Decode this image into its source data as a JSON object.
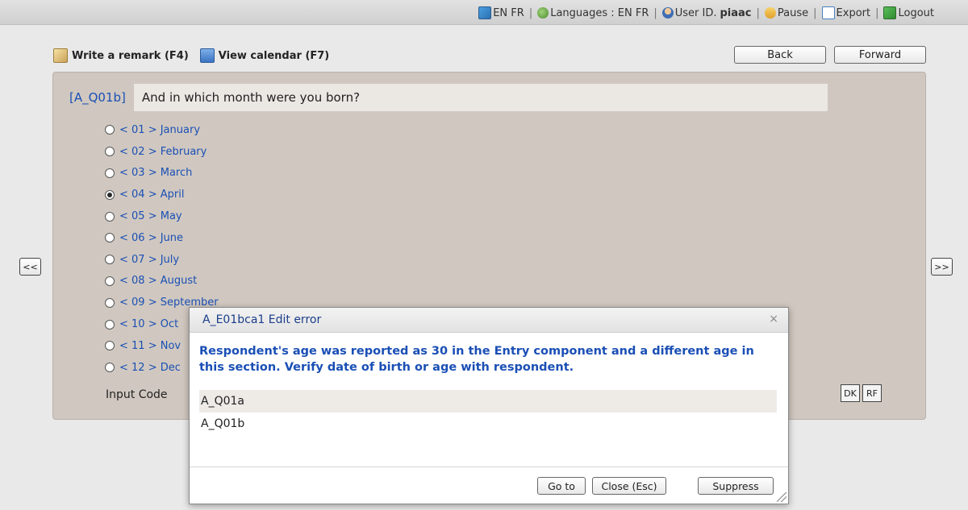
{
  "topbar": {
    "lang_toggle": "EN FR",
    "languages_label": "Languages : EN FR",
    "user_label": "User ID.",
    "user_id": "piaac",
    "pause": "Pause",
    "export": "Export",
    "logout": "Logout",
    "separator": "|"
  },
  "toolbar": {
    "remark": "Write a remark (F4)",
    "calendar": "View calendar (F7)",
    "back": "Back",
    "forward": "Forward"
  },
  "nav": {
    "prev": "<<",
    "next": ">>"
  },
  "question": {
    "code": "[A_Q01b]",
    "text": "And in which month were you born?",
    "options": [
      {
        "label": "< 01 > January",
        "checked": false
      },
      {
        "label": "< 02 > February",
        "checked": false
      },
      {
        "label": "< 03 > March",
        "checked": false
      },
      {
        "label": "< 04 > April",
        "checked": true
      },
      {
        "label": "< 05 > May",
        "checked": false
      },
      {
        "label": "< 06 > June",
        "checked": false
      },
      {
        "label": "< 07 > July",
        "checked": false
      },
      {
        "label": "< 08 > August",
        "checked": false
      },
      {
        "label": "< 09 > September",
        "checked": false
      },
      {
        "label": "< 10 > Oct",
        "checked": false
      },
      {
        "label": "< 11 > Nov",
        "checked": false
      },
      {
        "label": "< 12 > Dec",
        "checked": false
      }
    ],
    "input_code_label": "Input Code",
    "dk": "DK",
    "rf": "RF"
  },
  "dialog": {
    "title": "A_E01bca1 Edit error",
    "close_icon": "×",
    "message": "Respondent's age was reported as 30 in the Entry component and a different age in this section. Verify date of birth or age with respondent.",
    "items": [
      "A_Q01a",
      "A_Q01b"
    ],
    "goto": "Go to",
    "close": "Close (Esc)",
    "suppress": "Suppress"
  }
}
